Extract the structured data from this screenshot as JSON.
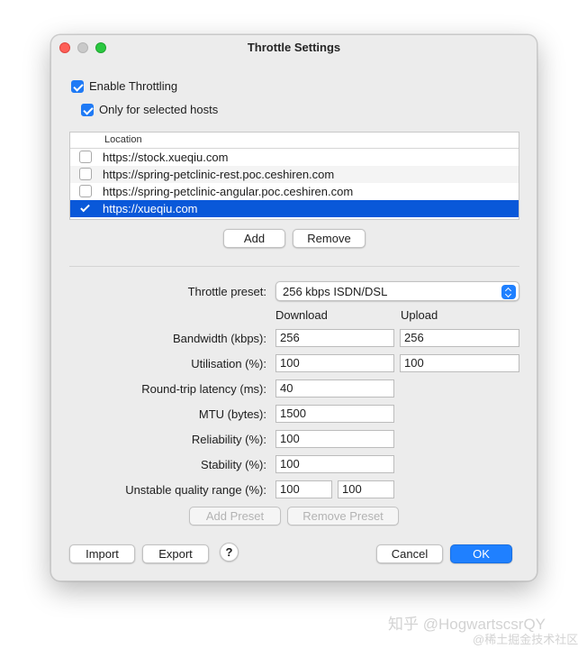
{
  "window": {
    "title": "Throttle Settings"
  },
  "options": {
    "enable_throttling": {
      "label": "Enable Throttling",
      "checked": true
    },
    "only_selected_hosts": {
      "label": "Only for selected hosts",
      "checked": true
    }
  },
  "hosts_table": {
    "column_header": "Location",
    "rows": [
      {
        "url": "https://stock.xueqiu.com",
        "checked": false,
        "selected": false
      },
      {
        "url": "https://spring-petclinic-rest.poc.ceshiren.com",
        "checked": false,
        "selected": false
      },
      {
        "url": "https://spring-petclinic-angular.poc.ceshiren.com",
        "checked": false,
        "selected": false
      },
      {
        "url": "https://xueqiu.com",
        "checked": true,
        "selected": true
      }
    ]
  },
  "host_buttons": {
    "add": "Add",
    "remove": "Remove"
  },
  "preset": {
    "label": "Throttle preset:",
    "value": "256 kbps ISDN/DSL"
  },
  "columns": {
    "download": "Download",
    "upload": "Upload"
  },
  "fields": {
    "bandwidth": {
      "label": "Bandwidth (kbps):",
      "download": "256",
      "upload": "256"
    },
    "utilisation": {
      "label": "Utilisation (%):",
      "download": "100",
      "upload": "100"
    },
    "latency": {
      "label": "Round-trip latency (ms):",
      "value": "40"
    },
    "mtu": {
      "label": "MTU (bytes):",
      "value": "1500"
    },
    "reliability": {
      "label": "Reliability (%):",
      "value": "100"
    },
    "stability": {
      "label": "Stability (%):",
      "value": "100"
    },
    "unstable_range": {
      "label": "Unstable quality range (%):",
      "min": "100",
      "max": "100"
    }
  },
  "preset_buttons": {
    "add": "Add Preset",
    "remove": "Remove Preset"
  },
  "footer": {
    "import": "Import",
    "export": "Export",
    "help": "?",
    "cancel": "Cancel",
    "ok": "OK"
  },
  "watermark": {
    "line1": "知乎 @HogwartscsrQY",
    "line2": "@稀土掘金技术社区"
  },
  "colors": {
    "accent": "#1f80ff",
    "selection": "#0958d9",
    "close": "#fe5f57",
    "zoom": "#2ac840"
  }
}
